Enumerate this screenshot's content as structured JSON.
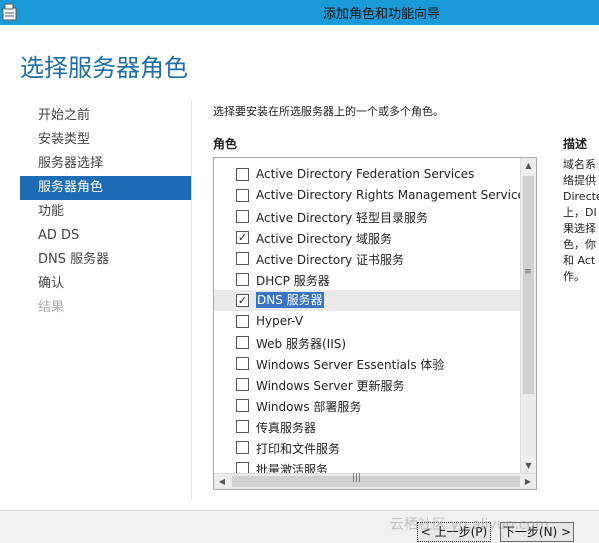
{
  "window": {
    "title": "添加角色和功能向导"
  },
  "page": {
    "heading": "选择服务器角色"
  },
  "nav": {
    "items": [
      {
        "label": "开始之前",
        "state": "normal"
      },
      {
        "label": "安装类型",
        "state": "normal"
      },
      {
        "label": "服务器选择",
        "state": "normal"
      },
      {
        "label": "服务器角色",
        "state": "selected"
      },
      {
        "label": "功能",
        "state": "normal"
      },
      {
        "label": "AD DS",
        "state": "normal"
      },
      {
        "label": "DNS 服务器",
        "state": "normal"
      },
      {
        "label": "确认",
        "state": "normal"
      },
      {
        "label": "结果",
        "state": "disabled"
      }
    ]
  },
  "main": {
    "intro": "选择要安装在所选服务器上的一个或多个角色。",
    "roles_header": "角色",
    "description_header": "描述",
    "description_lines": [
      "域名系",
      "络提供",
      "Directe",
      "上，DI",
      "果选择",
      "色，你",
      "和 Act",
      "作。"
    ]
  },
  "roles": [
    {
      "label": "Active Directory Federation Services",
      "checked": false
    },
    {
      "label": "Active Directory Rights Management Services",
      "checked": false
    },
    {
      "label": "Active Directory 轻型目录服务",
      "checked": false
    },
    {
      "label": "Active Directory 域服务",
      "checked": true
    },
    {
      "label": "Active Directory 证书服务",
      "checked": false
    },
    {
      "label": "DHCP 服务器",
      "checked": false
    },
    {
      "label": "DNS 服务器",
      "checked": true,
      "selected": true
    },
    {
      "label": "Hyper-V",
      "checked": false
    },
    {
      "label": "Web 服务器(IIS)",
      "checked": false
    },
    {
      "label": "Windows Server Essentials 体验",
      "checked": false
    },
    {
      "label": "Windows Server 更新服务",
      "checked": false
    },
    {
      "label": "Windows 部署服务",
      "checked": false
    },
    {
      "label": "传真服务器",
      "checked": false
    },
    {
      "label": "打印和文件服务",
      "checked": false
    },
    {
      "label": "批量激活服务",
      "checked": false
    }
  ],
  "footer": {
    "prev_label": "< 上一步(P)",
    "next_label": "下一步(N) >",
    "watermark": "云栖社区 yq.aliyun.com"
  },
  "colors": {
    "titlebar": "#1a9ad6",
    "heading": "#1f6fa8",
    "nav_selected": "#1e6cb4",
    "item_highlight": "#3a74c5"
  }
}
